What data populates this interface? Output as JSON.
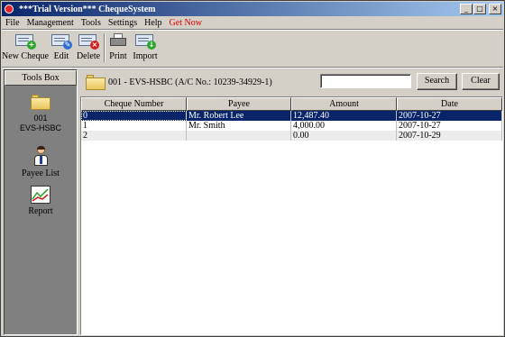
{
  "window": {
    "title": "***Trial Version*** ChequeSystem",
    "buttons": {
      "minimize": "_",
      "maximize": "□",
      "close": "×"
    }
  },
  "menu": [
    "File",
    "Management",
    "Tools",
    "Settings",
    "Help",
    "Get Now"
  ],
  "toolbar": {
    "new_cheque": "New Cheque",
    "edit": "Edit",
    "delete": "Delete",
    "print": "Print",
    "import": "Import"
  },
  "toolsbox": {
    "header": "Tools Box",
    "account_number": "001",
    "account_name": "EVS-HSBC",
    "payee_list": "Payee List",
    "report": "Report"
  },
  "account_bar": {
    "text": "001 -   EVS-HSBC   (A/C No.: 10239-34929-1)",
    "search_value": "",
    "search_button": "Search",
    "clear_button": "Clear"
  },
  "table": {
    "columns": [
      "Cheque Number",
      "Payee",
      "Amount",
      "Date"
    ],
    "rows": [
      [
        "0",
        "Mr. Robert Lee",
        "12,487.40",
        "2007-10-27"
      ],
      [
        "1",
        "Mr. Smith",
        "4,000.00",
        "2007-10-27"
      ],
      [
        "2",
        "",
        "0.00",
        "2007-10-29"
      ]
    ],
    "selected_row": 0
  },
  "colors": {
    "titlebar_start": "#0a246a",
    "titlebar_end": "#a6caf0",
    "selection": "#0a246a",
    "get_now": "#e00000"
  }
}
